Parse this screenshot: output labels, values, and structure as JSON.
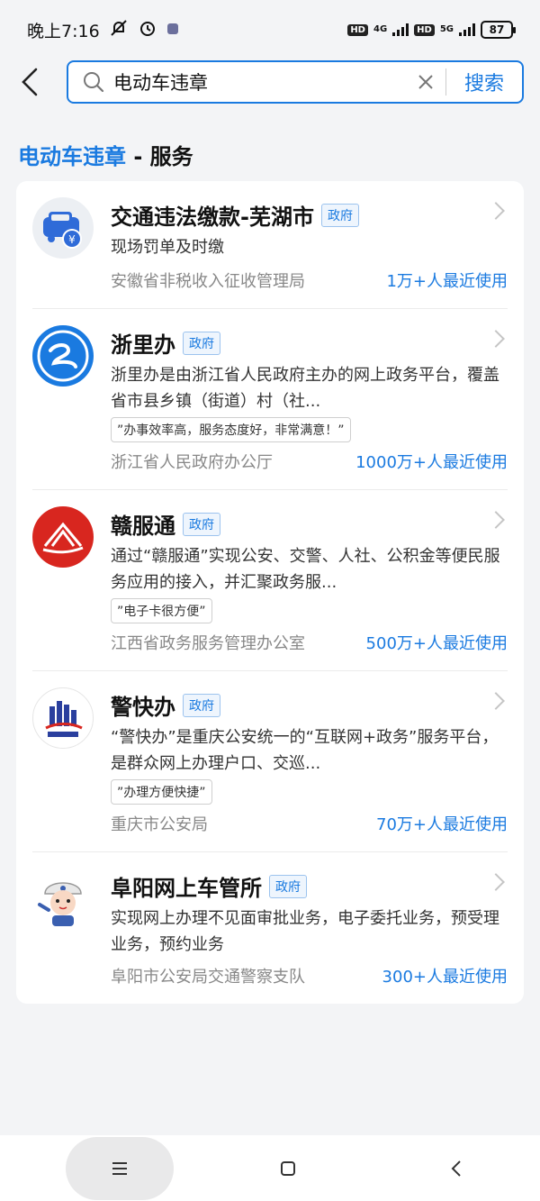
{
  "status": {
    "time": "晚上7:16",
    "net1": "4G",
    "net2": "5G",
    "hd": "HD",
    "battery": "87"
  },
  "search": {
    "query": "电动车违章",
    "button": "搜索"
  },
  "section": {
    "keyword": "电动车违章",
    "suffix": " - 服务"
  },
  "results": [
    {
      "title": "交通违法缴款-芜湖市",
      "tag": "政府",
      "desc": "现场罚单及时缴",
      "quote": "",
      "org": "安徽省非税收入征收管理局",
      "usage": "1万+人最近使用",
      "logo": "car-yen-icon"
    },
    {
      "title": "浙里办",
      "tag": "政府",
      "desc": "浙里办是由浙江省人民政府主办的网上政务平台，覆盖省市县乡镇（街道）村（社...",
      "quote": "”办事效率高，服务态度好，非常满意！”",
      "org": "浙江省人民政府办公厅",
      "usage": "1000万+人最近使用",
      "logo": "zheliban-logo"
    },
    {
      "title": "赣服通",
      "tag": "政府",
      "desc": "通过“赣服通”实现公安、交警、人社、公积金等便民服务应用的接入，并汇聚政务服...",
      "quote": "”电子卡很方便”",
      "org": "江西省政务服务管理办公室",
      "usage": "500万+人最近使用",
      "logo": "ganfutong-logo"
    },
    {
      "title": "警快办",
      "tag": "政府",
      "desc": "“警快办”是重庆公安统一的“互联网+政务”服务平台，是群众网上办理户口、交巡...",
      "quote": "”办理方便快捷”",
      "org": "重庆市公安局",
      "usage": "70万+人最近使用",
      "logo": "jingkuaiban-logo"
    },
    {
      "title": "阜阳网上车管所",
      "tag": "政府",
      "desc": "实现网上办理不见面审批业务，电子委托业务，预受理业务，预约业务",
      "quote": "",
      "org": "阜阳市公安局交通警察支队",
      "usage": "300+人最近使用",
      "logo": "police-cartoon-logo"
    }
  ],
  "colors": {
    "accent": "#1a7ae0",
    "background": "#f3f4f6"
  }
}
